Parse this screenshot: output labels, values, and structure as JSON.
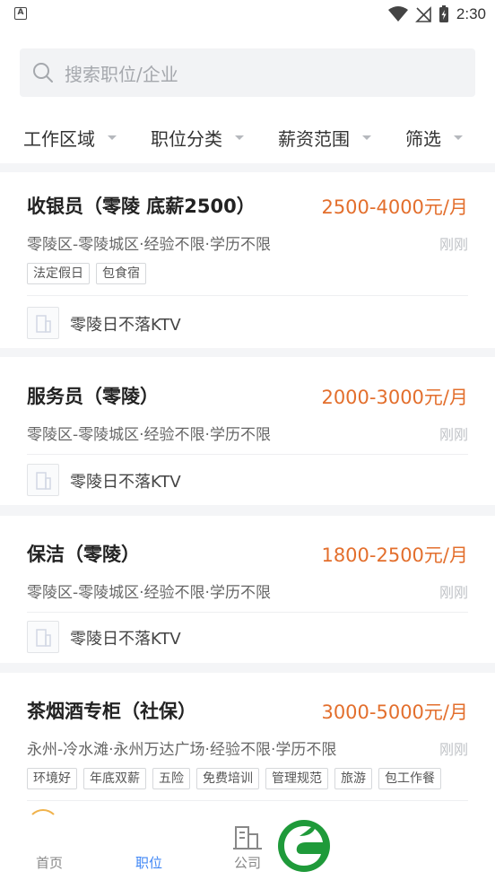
{
  "status_bar": {
    "left_icon": "a-letter-icon",
    "time": "2:30",
    "icons": [
      "wifi-icon",
      "no-signal-icon",
      "battery-charging-icon"
    ]
  },
  "search": {
    "placeholder": "搜索职位/企业",
    "icon": "search-icon"
  },
  "filters": [
    {
      "label": "工作区域"
    },
    {
      "label": "职位分类"
    },
    {
      "label": "薪资范围"
    },
    {
      "label": "筛选"
    }
  ],
  "jobs": [
    {
      "title": "收银员（零陵 底薪2500）",
      "salary": "2500-4000元/月",
      "meta": "零陵区-零陵城区·经验不限·学历不限",
      "time": "刚刚",
      "tags": [
        "法定假日",
        "包食宿"
      ],
      "company": "零陵日不落KTV"
    },
    {
      "title": "服务员（零陵）",
      "salary": "2000-3000元/月",
      "meta": "零陵区-零陵城区·经验不限·学历不限",
      "time": "刚刚",
      "tags": [],
      "company": "零陵日不落KTV"
    },
    {
      "title": "保洁（零陵）",
      "salary": "1800-2500元/月",
      "meta": "零陵区-零陵城区·经验不限·学历不限",
      "time": "刚刚",
      "tags": [],
      "company": "零陵日不落KTV"
    },
    {
      "title": "茶烟酒专柜（社保）",
      "salary": "3000-5000元/月",
      "meta": "永州-冷水滩·永州万达广场·经验不限·学历不限",
      "time": "刚刚",
      "tags": [
        "环境好",
        "年底双薪",
        "五险",
        "免费培训",
        "管理规范",
        "旅游",
        "包工作餐"
      ],
      "company": ""
    }
  ],
  "tabs": [
    {
      "label": "首页",
      "active": false
    },
    {
      "label": "职位",
      "active": true
    },
    {
      "label": "公司",
      "active": false,
      "icon": "building-icon"
    }
  ],
  "colors": {
    "salary": "#e36f2d",
    "active_tab": "#3f86f5",
    "brand_green": "#1f9a3a"
  }
}
